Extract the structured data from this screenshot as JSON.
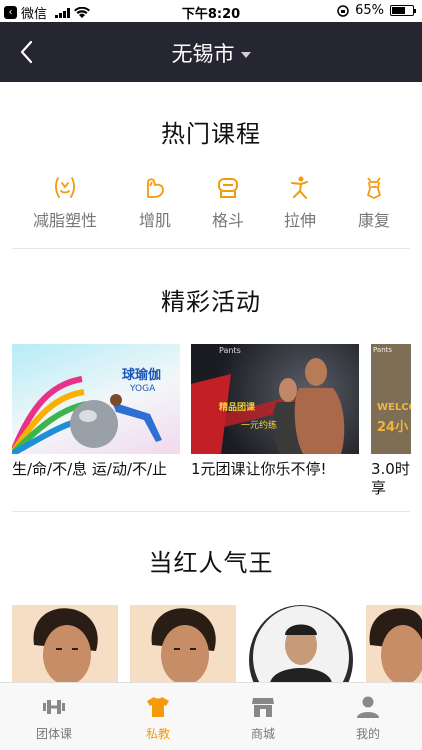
{
  "status_bar": {
    "app": "微信",
    "time": "下午8:20",
    "battery": "65%",
    "battery_level": 0.65
  },
  "navbar": {
    "city": "无锡市"
  },
  "sections": {
    "courses_title": "热门课程",
    "activities_title": "精彩活动",
    "popular_title": "当红人气王"
  },
  "categories": [
    {
      "label": "减脂塑性",
      "icon": "slim-body-icon"
    },
    {
      "label": "增肌",
      "icon": "muscle-arm-icon"
    },
    {
      "label": "格斗",
      "icon": "boxing-icon"
    },
    {
      "label": "拉伸",
      "icon": "stretch-icon"
    },
    {
      "label": "康复",
      "icon": "rehab-icon"
    }
  ],
  "activities": [
    {
      "caption": "生/命/不/息 运/动/不/止",
      "image_text": "球瑜伽",
      "image_sub": "YOGA"
    },
    {
      "caption": "1元团课让你乐不停!",
      "image_text": "精品团课",
      "image_sub": "一元约练",
      "brand": "Pants"
    },
    {
      "caption": "3.0时享",
      "image_text": "WELCO",
      "image_sub": "24小",
      "brand": "Pants"
    }
  ],
  "tabs": [
    {
      "label": "团体课",
      "icon": "dumbbell-icon",
      "active": false
    },
    {
      "label": "私教",
      "icon": "shirt-icon",
      "active": true
    },
    {
      "label": "商城",
      "icon": "shop-icon",
      "active": false
    },
    {
      "label": "我的",
      "icon": "user-icon",
      "active": false
    }
  ],
  "colors": {
    "accent": "#f49a0b",
    "navbar": "#252631",
    "inactive": "#777777"
  }
}
